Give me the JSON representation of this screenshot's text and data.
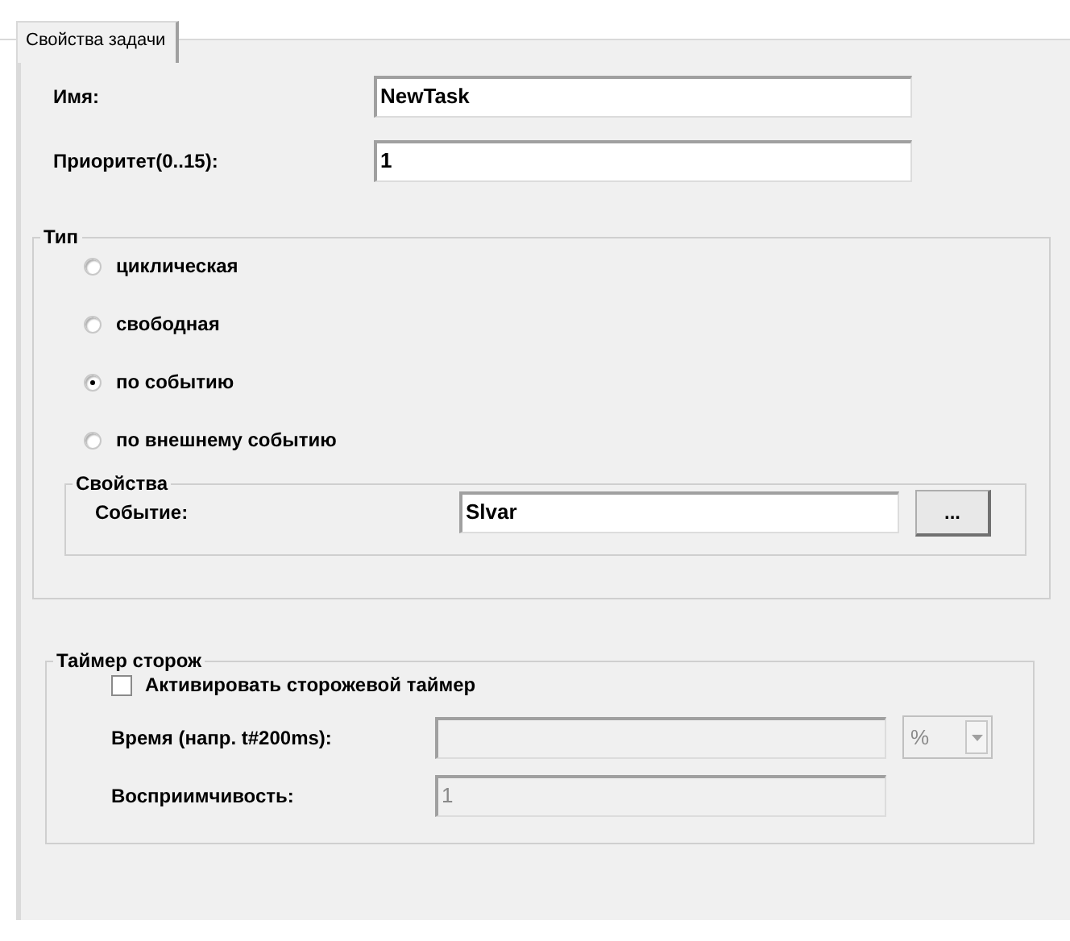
{
  "tabs": [
    {
      "label": "Свойства задачи",
      "selected": true
    }
  ],
  "fields": [
    {
      "label": "Имя:",
      "value": "NewTask"
    },
    {
      "label": "Приоритет(0..15):",
      "value": "1"
    }
  ],
  "type_group": {
    "title": "Тип",
    "options": [
      {
        "label": "циклическая",
        "selected": false
      },
      {
        "label": "свободная",
        "selected": false
      },
      {
        "label": "по событию",
        "selected": true
      },
      {
        "label": "по внешнему событию",
        "selected": false
      }
    ],
    "properties": {
      "title": "Свойства",
      "label": "Событие:",
      "value": "Slvar",
      "button": "..."
    }
  },
  "watchdog": {
    "title": "Таймер сторож",
    "checkbox": {
      "label": "Активировать сторожевой таймер",
      "checked": false
    },
    "time": {
      "label": "Время (напр. t#200ms):",
      "disabled": true,
      "unit": "%"
    },
    "sensitivity": {
      "label": "Восприимчивость:",
      "value": "1",
      "disabled": true
    }
  }
}
